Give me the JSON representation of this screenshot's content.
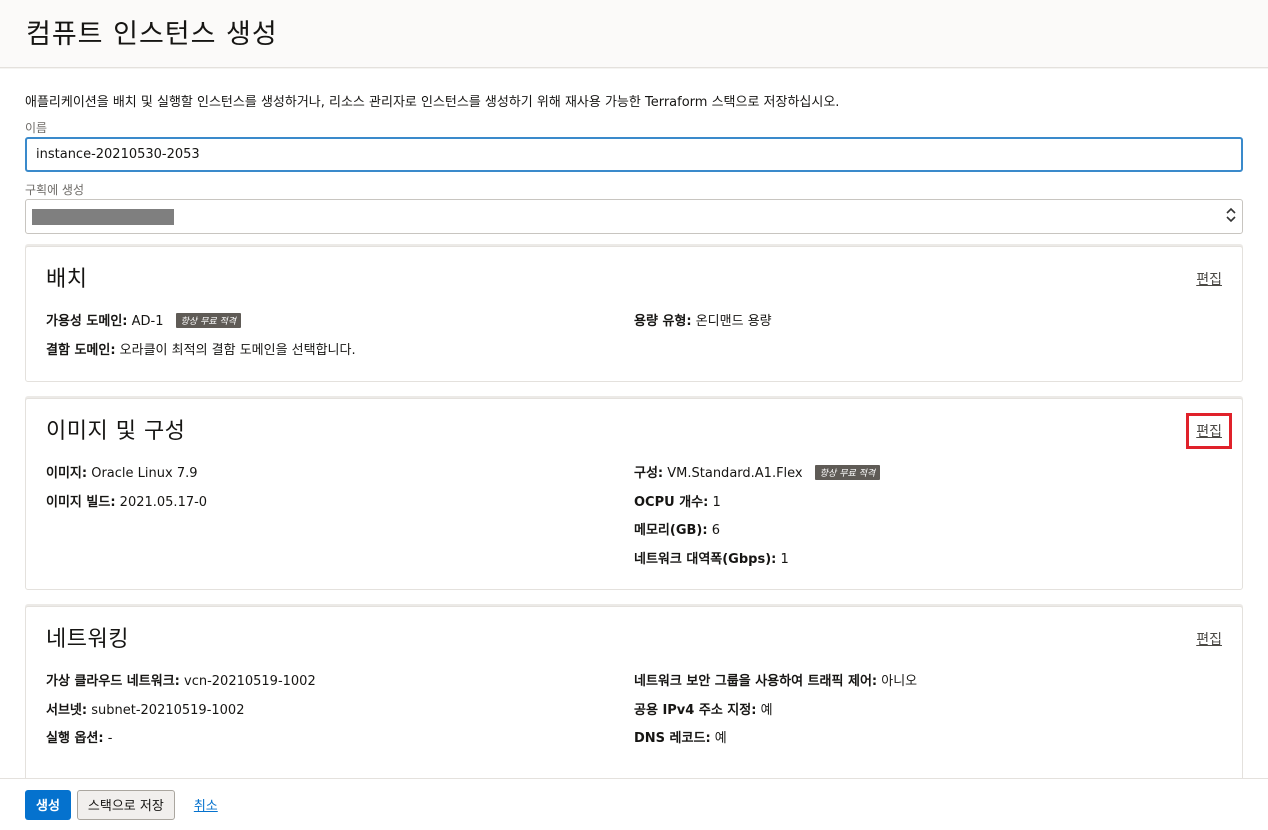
{
  "page": {
    "title": "컴퓨트 인스턴스 생성"
  },
  "form": {
    "description": "애플리케이션을 배치 및 실행할 인스턴스를 생성하거나, 리소스 관리자로 인스턴스를 생성하기 위해 재사용 가능한 Terraform 스택으로 저장하십시오.",
    "name_label": "이름",
    "name_value": "instance-20210530-2053",
    "compartment_label": "구획에 생성"
  },
  "placement": {
    "title": "배치",
    "edit_label": "편집",
    "availability_domain_label": "가용성 도메인:",
    "availability_domain_value": "AD-1",
    "badge": "항상 무료 적격",
    "fault_domain_label": "결함 도메인:",
    "fault_domain_value": "오라클이 최적의 결함 도메인을 선택합니다.",
    "capacity_type_label": "용량 유형:",
    "capacity_type_value": "온디맨드 용량"
  },
  "image_config": {
    "title": "이미지 및 구성",
    "edit_label": "편집",
    "image_label": "이미지:",
    "image_value": "Oracle Linux 7.9",
    "image_build_label": "이미지 빌드:",
    "image_build_value": "2021.05.17-0",
    "shape_label": "구성:",
    "shape_value": "VM.Standard.A1.Flex",
    "badge": "항상 무료 적격",
    "ocpu_label": "OCPU 개수:",
    "ocpu_value": "1",
    "memory_label": "메모리(GB):",
    "memory_value": "6",
    "bandwidth_label": "네트워크 대역폭(Gbps):",
    "bandwidth_value": "1"
  },
  "networking": {
    "title": "네트워킹",
    "edit_label": "편집",
    "vcn_label": "가상 클라우드 네트워크:",
    "vcn_value": "vcn-20210519-1002",
    "subnet_label": "서브넷:",
    "subnet_value": "subnet-20210519-1002",
    "launch_options_label": "실행 옵션:",
    "launch_options_value": "-",
    "nsg_label": "네트워크 보안 그룹을 사용하여 트래픽 제어:",
    "nsg_value": "아니오",
    "public_ip_label": "공용 IPv4 주소 지정:",
    "public_ip_value": "예",
    "dns_label": "DNS 레코드:",
    "dns_value": "예"
  },
  "footer": {
    "create_label": "생성",
    "save_stack_label": "스택으로 저장",
    "cancel_label": "취소"
  },
  "colors": {
    "primary": "#0572ce",
    "highlight": "#e0212a",
    "badge": "#5f5b56"
  }
}
